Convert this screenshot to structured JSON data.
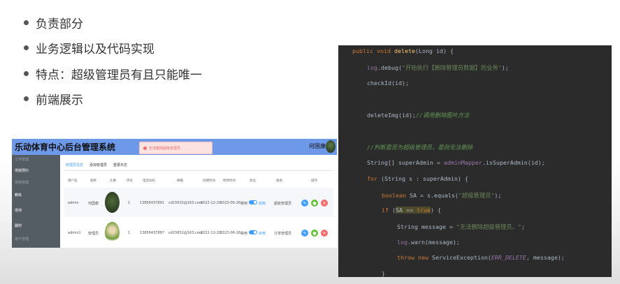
{
  "bullets": [
    "负责部分",
    "业务逻辑以及代码实现",
    "特点：超级管理员有且只能唯一",
    "前端展示"
  ],
  "admin": {
    "title": "乐动体育中心后台管理系统",
    "user_name": "何国康",
    "toast": "无法删除超级管理员",
    "sidebar_items": [
      {
        "label": "工作管理",
        "muted": true
      },
      {
        "label": "场馆预约",
        "muted": false
      },
      {
        "label": "场馆管理",
        "muted": true
      },
      {
        "label": "教练",
        "muted": false
      },
      {
        "label": "场地",
        "muted": false
      },
      {
        "label": "器材",
        "muted": false
      },
      {
        "label": "用户管理",
        "muted": true
      }
    ],
    "tabs": [
      "管理员信息",
      "添加管理员",
      "登录日志"
    ],
    "columns": [
      "用户名",
      "昵称",
      "头像",
      "序号",
      "电话号码",
      "邮箱",
      "创建时间",
      "修改时间",
      "状态",
      "角色",
      "操作"
    ],
    "rows": [
      {
        "username": "admin",
        "nickname": "何国康",
        "seq": "1",
        "phone": "13856437891",
        "email": "cd15632@163.com",
        "created": "2022-12-20",
        "modified": "2023-06-26",
        "status": "禁用",
        "status_on": "启用",
        "role": "超级管理员"
      },
      {
        "username": "admin1",
        "nickname": "管理员",
        "seq": "1",
        "phone": "13856437897",
        "email": "cd15652@163.com",
        "created": "2022-12-20",
        "modified": "2023-06-26",
        "status": "禁用",
        "status_on": "启用",
        "role": "订单管理员"
      }
    ]
  },
  "code": {
    "sig_public": "public",
    "sig_void": "void",
    "sig_name": "delete",
    "sig_params": "(Long id) {",
    "log_obj": "log",
    "log_debug": ".debug(",
    "log_debug_str": "\"开始执行【删除管理员数据】的业务\"",
    "log_debug_end": ");",
    "check": "checkId(id);",
    "delete_img": "deleteImg(id);",
    "delete_img_comment": "//调用删除图片方法",
    "judge_comment": "//判断是否为超级管理员，是则无法删除",
    "super_admin_line": "String[] superAdmin = ",
    "mapper": "adminMapper",
    "mapper_call": ".isSuperAdmin(id);",
    "for_kw": "for",
    "for_rest": " (String s : superAdmin) {",
    "bool_kw": "boolean",
    "bool_rest": " SA = s.equals(",
    "bool_str": "\"超级管理员\"",
    "bool_end": ");",
    "if_kw": "if",
    "if_open": " (",
    "if_cond": "SA == ",
    "if_true": "true",
    "if_close": ") {",
    "msg_line": "String message = ",
    "msg_str": "\"无法删除超级管理员。\"",
    "msg_end": ";",
    "warn_obj": "log",
    "warn_rest": ".warn(message);",
    "throw_kw": "throw",
    "new_kw": "new",
    "exc": " ServiceException(",
    "err_const": "ERR_DELETE",
    "exc_end": ", message);",
    "close_brace": "}"
  },
  "colors": {
    "header": "#6e98e8",
    "sidebar": "#545c64",
    "code_bg": "#2b2b2b",
    "primary": "#409eff"
  }
}
